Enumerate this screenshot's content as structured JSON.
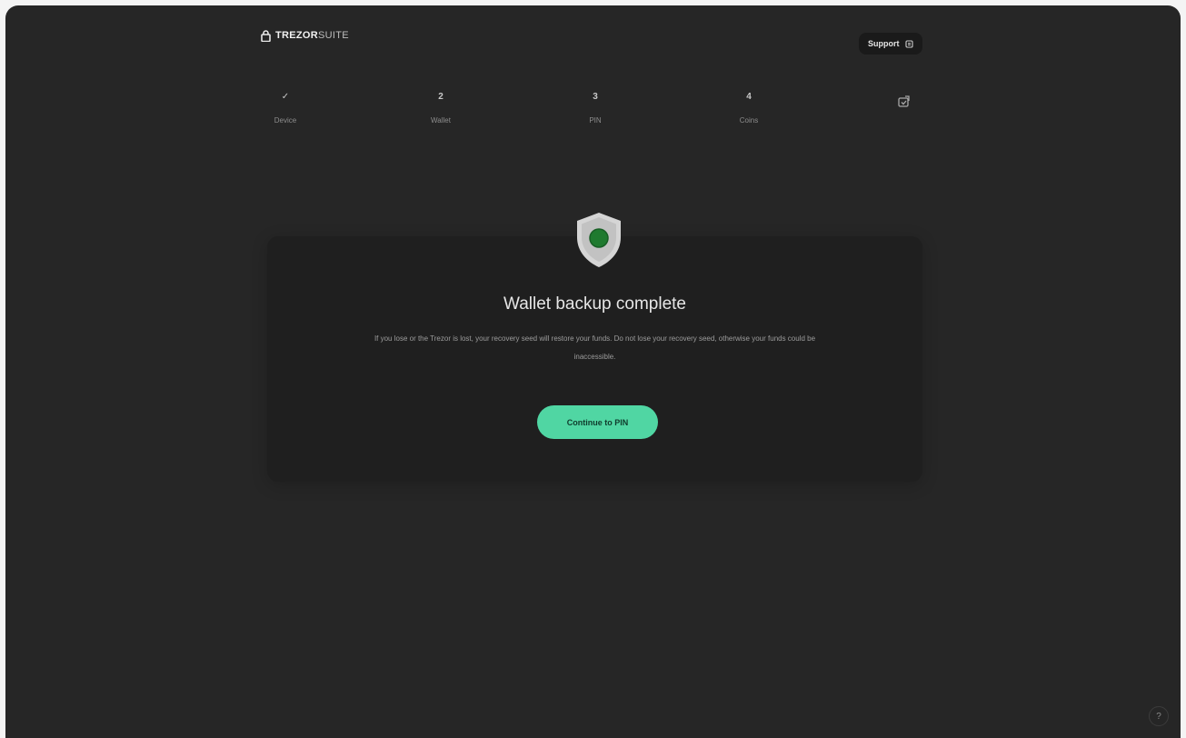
{
  "app": {
    "logo_bold": "TREZOR",
    "logo_light": "SUITE",
    "logo_icon": "lock-icon"
  },
  "header": {
    "support_label": "Support",
    "support_icon": "support-icon"
  },
  "stepper": {
    "steps": [
      {
        "number": "✓",
        "label": "Device"
      },
      {
        "number": "2",
        "label": "Wallet"
      },
      {
        "number": "3",
        "label": "PIN"
      },
      {
        "number": "4",
        "label": "Coins"
      }
    ],
    "final_icon": "wallet-check-icon"
  },
  "card": {
    "icon": "shield-check-icon",
    "title": "Wallet backup complete",
    "description": "If you lose or the Trezor is lost, your recovery seed will restore your funds. Do not lose your recovery seed, otherwise your funds could be inaccessible.",
    "button_label": "Continue to PIN"
  },
  "footer": {
    "help_label": "?",
    "help_icon": "help-icon"
  },
  "colors": {
    "background": "#262626",
    "card": "#1f1f1f",
    "accent": "#50d6a3",
    "shield": "#d5d5d5",
    "shield_dot": "#1f7a2f"
  }
}
